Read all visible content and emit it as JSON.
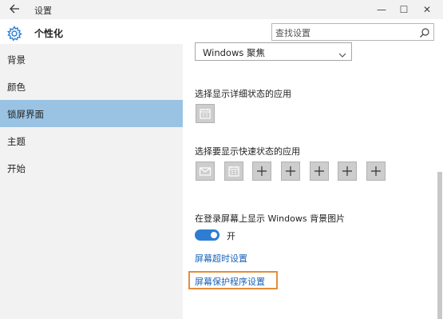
{
  "titlebar": {
    "title": "设置",
    "back_icon": "back-arrow-icon",
    "minimize_symbol": "—",
    "maximize_symbol": "☐",
    "close_symbol": "✕"
  },
  "header": {
    "title": "个性化",
    "icon": "gear-icon"
  },
  "search": {
    "placeholder": "查找设置"
  },
  "sidebar": {
    "items": [
      {
        "label": "背景",
        "active": false
      },
      {
        "label": "颜色",
        "active": false
      },
      {
        "label": "锁屏界面",
        "active": true
      },
      {
        "label": "主题",
        "active": false
      },
      {
        "label": "开始",
        "active": false
      }
    ]
  },
  "main": {
    "background_dropdown_value": "Windows 聚焦",
    "detailed_status_label": "选择显示详细状态的应用",
    "quick_status_label": "选择要显示快速状态的应用",
    "quick_status_tiles": [
      "mail-icon",
      "calendar-icon",
      "plus-icon",
      "plus-icon",
      "plus-icon",
      "plus-icon",
      "plus-icon"
    ],
    "show_background_label": "在登录屏幕上显示 Windows 背景图片",
    "toggle_state": "开",
    "toggle_on": true,
    "link_timeout": "屏幕超时设置",
    "link_screensaver": "屏幕保护程序设置"
  },
  "colors": {
    "accent": "#2e7dd2",
    "sidebar_active": "#9ac3e3",
    "highlight_border": "#e58e3a",
    "link": "#1a63b8"
  }
}
